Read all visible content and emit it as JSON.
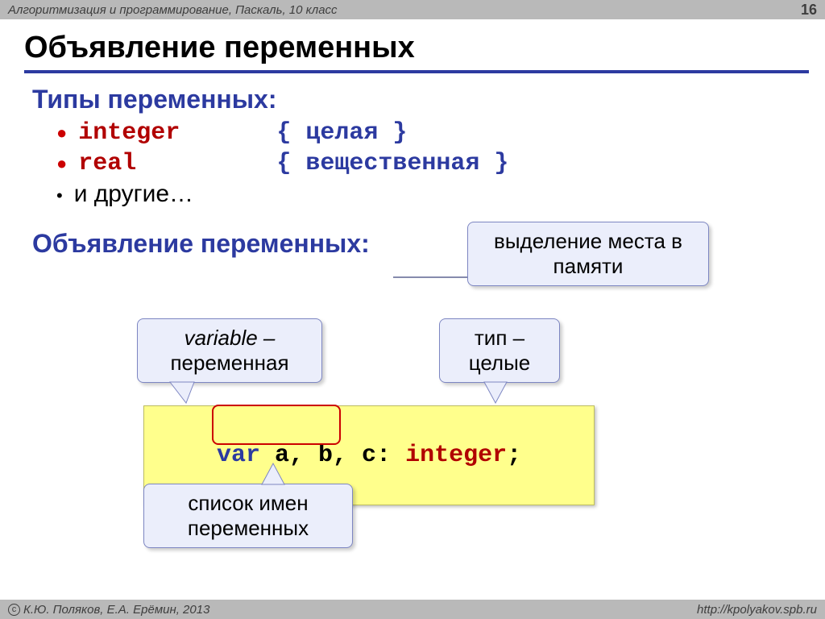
{
  "meta": {
    "breadcrumb": "Алгоритмизация и программирование, Паскаль, 10 класс",
    "page": "16",
    "copyright": "К.Ю. Поляков, Е.А. Ерёмин, 2013",
    "url": "http://kpolyakov.spb.ru"
  },
  "title": "Объявление переменных",
  "sections": {
    "types_heading": "Типы переменных:",
    "decl_heading": "Объявление переменных:"
  },
  "types": {
    "integer_kw": "integer",
    "integer_cmt": "{ целая }",
    "real_kw": "real",
    "real_cmt": "{ вещественная }",
    "others": "и другие…"
  },
  "callouts": {
    "memory": "выделение места в памяти",
    "variable": "variable – переменная",
    "type": "тип – целые",
    "names": "список имен переменных"
  },
  "code": {
    "var": "var ",
    "names": "a, b, c",
    "colon": ": ",
    "type": "integer",
    "semi": ";"
  }
}
